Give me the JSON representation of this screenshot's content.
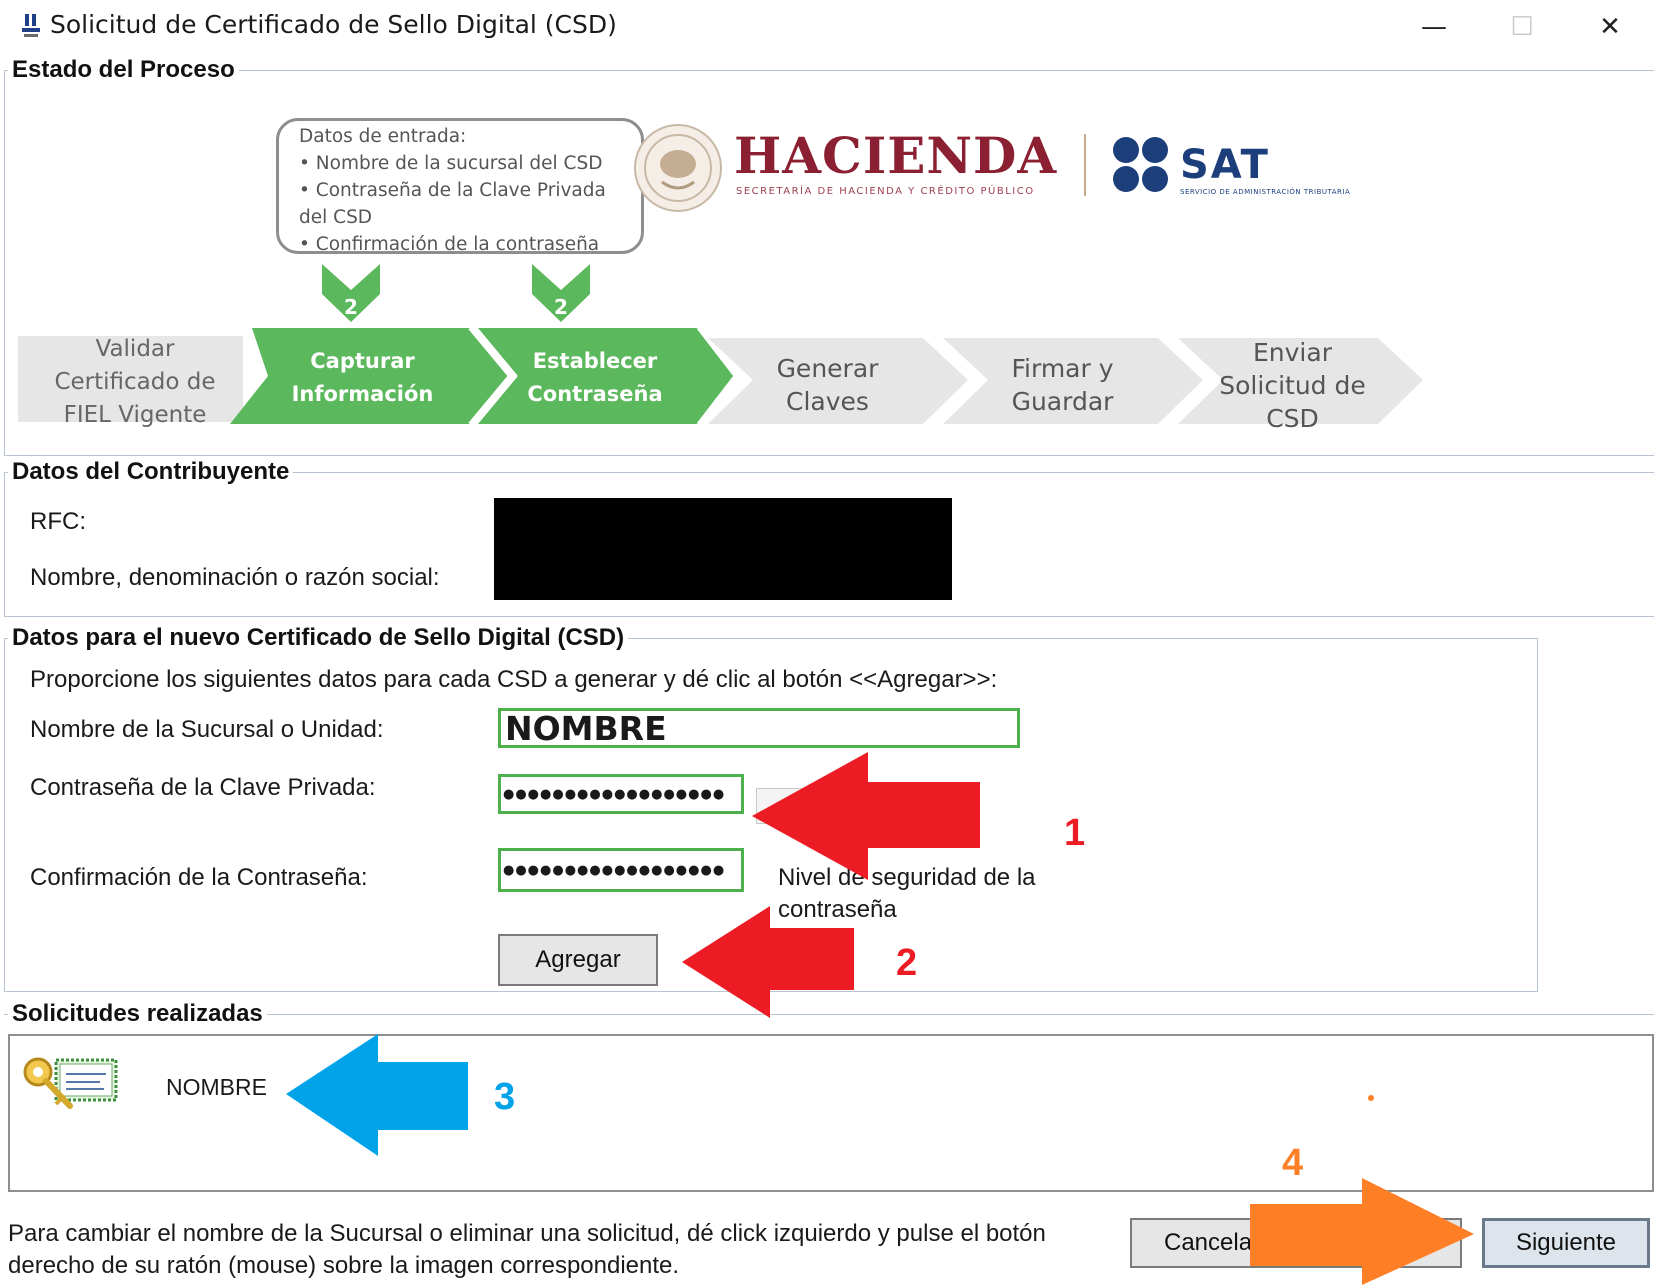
{
  "window": {
    "title": "Solicitud de Certificado de Sello Digital (CSD)",
    "minimize": "—",
    "maximize": "☐",
    "close": "✕"
  },
  "proceso": {
    "legend": "Estado del Proceso",
    "callout": {
      "title": "Datos de entrada:",
      "items": [
        "Nombre de la sucursal del CSD",
        "Contraseña de la Clave Privada del CSD",
        "Confirmación de la contraseña"
      ]
    },
    "badges": [
      "2",
      "2"
    ],
    "steps": [
      {
        "label": "Validar Certificado de FIEL Vigente",
        "active": false
      },
      {
        "label": "Capturar Información",
        "active": true
      },
      {
        "label": "Establecer Contraseña",
        "active": true
      },
      {
        "label": "Generar Claves",
        "active": false
      },
      {
        "label": "Firmar y Guardar",
        "active": false
      },
      {
        "label": "Enviar Solicitud de CSD",
        "active": false
      }
    ],
    "logos": {
      "hacienda": "HACIENDA",
      "hacienda_sub": "SECRETARÍA DE HACIENDA Y CRÉDITO PÚBLICO",
      "sat": "SAT",
      "sat_sub": "SERVICIO DE ADMINISTRACIÓN TRIBUTARIA"
    }
  },
  "contribuyente": {
    "legend": "Datos del Contribuyente",
    "rfc_label": "RFC:",
    "nombre_label": "Nombre, denominación o razón social:"
  },
  "csd": {
    "legend": "Datos para el nuevo Certificado de Sello Digital (CSD)",
    "instructions": "Proporcione los siguientes datos para cada CSD a generar y dé clic al botón <<Agregar>>:",
    "sucursal_label": "Nombre de la Sucursal o Unidad:",
    "sucursal_value": "NOMBRE",
    "password_label": "Contraseña de la Clave Privada:",
    "password_value": "●●●●●●●●●●●●●●●●●●",
    "confirm_label": "Confirmación de la Contraseña:",
    "confirm_value": "●●●●●●●●●●●●●●●●●●",
    "nivel_label_1": "Nivel de seguridad de la",
    "nivel_label_2": "contraseña",
    "agregar_button": "Agregar"
  },
  "solicitudes": {
    "legend": "Solicitudes realizadas",
    "items": [
      {
        "name": "NOMBRE"
      }
    ]
  },
  "footer": {
    "help_line1": "Para cambiar el nombre de la Sucursal o eliminar una solicitud, dé click izquierdo y pulse el botón",
    "help_line2": "derecho de su ratón (mouse) sobre la imagen correspondiente.",
    "cancel_button": "Cancelar",
    "next_button": "Siguiente"
  },
  "annotations": {
    "numbers": [
      "1",
      "2",
      "3",
      "4"
    ],
    "colors": {
      "red": "#ed1c24",
      "blue": "#00a2e8",
      "orange": "#ff7f27",
      "green": "#5cb85c"
    }
  }
}
